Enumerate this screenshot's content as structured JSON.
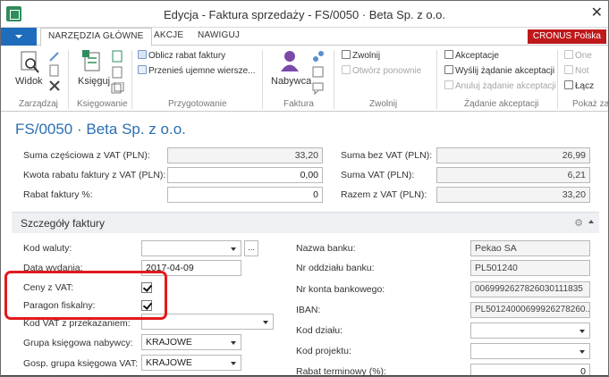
{
  "window": {
    "title": "Edycja - Faktura sprzedaży - FS/0050 · Beta Sp. z o.o.",
    "close_glyph": "✕"
  },
  "ribbon_tabs": {
    "home": "NARZĘDZIA GŁÓWNE",
    "actions": "AKCJE",
    "navigate": "NAWIGUJ",
    "company": "CRONUS Polska"
  },
  "ribbon": {
    "view": "Widok",
    "post": "Księguj",
    "calc_discount": "Oblicz rabat faktury",
    "move_lines": "Przenieś ujemne wiersze...",
    "customer": "Nabywca",
    "release": "Zwolnij",
    "reopen": "Otwórz ponownie",
    "approvals": "Akceptacje",
    "send_approval": "Wyślij żądanie akceptacji",
    "cancel_approval": "Anuluj żądanie akceptacji",
    "onenote": "One",
    "notes": "Not",
    "links": "Łącz",
    "groups": {
      "manage": "Zarządzaj",
      "posting": "Księgowanie",
      "prepare": "Przygotowanie",
      "invoice": "Faktura",
      "release": "Zwolnij",
      "approval_request": "Żądanie akceptacji",
      "show_attached": "Pokaż za"
    },
    "icons": {
      "view": "magnifier-doc-icon",
      "customer": "person-icon",
      "release": "release-doc-icon",
      "approvals": "approval-doc-icon"
    }
  },
  "page": {
    "title": "FS/0050 · Beta Sp. z o.o."
  },
  "totals": {
    "subtotal_incl_vat_label": "Suma częściowa z VAT (PLN):",
    "subtotal_incl_vat": "33,20",
    "inv_discount_incl_vat_label": "Kwota rabatu faktury z VAT (PLN):",
    "inv_discount_incl_vat": "0,00",
    "inv_discount_pct_label": "Rabat faktury %:",
    "inv_discount_pct": "0",
    "total_excl_vat_label": "Suma bez VAT (PLN):",
    "total_excl_vat": "26,99",
    "total_vat_label": "Suma VAT (PLN):",
    "total_vat": "6,21",
    "total_incl_vat_label": "Razem z VAT (PLN):",
    "total_incl_vat": "33,20"
  },
  "details": {
    "section_title": "Szczegóły faktury",
    "currency_code_label": "Kod waluty:",
    "currency_code": "",
    "ellipsis": "...",
    "issue_date_label": "Data wydania:",
    "issue_date": "2017-04-09",
    "prices_incl_vat_label": "Ceny z VAT:",
    "prices_incl_vat": true,
    "fiscal_receipt_label": "Paragon fiskalny:",
    "fiscal_receipt": true,
    "vat_transfer_code_label": "Kod VAT z przekazaniem:",
    "vat_transfer_code": "",
    "customer_posting_group_label": "Grupa księgowa nabywcy:",
    "customer_posting_group": "KRAJOWE",
    "vat_bus_posting_group_label": "Gosp. grupa księgowa VAT:",
    "vat_bus_posting_group": "KRAJOWE",
    "bank_name_label": "Nazwa banku:",
    "bank_name": "Pekao SA",
    "bank_branch_label": "Nr oddziału banku:",
    "bank_branch": "PL501240",
    "bank_account_label": "Nr konta bankowego:",
    "bank_account": "0069992627826030111835",
    "iban_label": "IBAN:",
    "iban": "PL50124000699926278260...",
    "dept_code_label": "Kod działu:",
    "dept_code": "",
    "project_code_label": "Kod projektu:",
    "project_code": "",
    "payment_discount_label": "Rabat terminowy (%):",
    "payment_discount": "0"
  },
  "colors": {
    "accent": "#1f6cbd",
    "company_badge": "#c0191b",
    "page_title": "#2a6fb5",
    "highlight": "#e3191d"
  }
}
